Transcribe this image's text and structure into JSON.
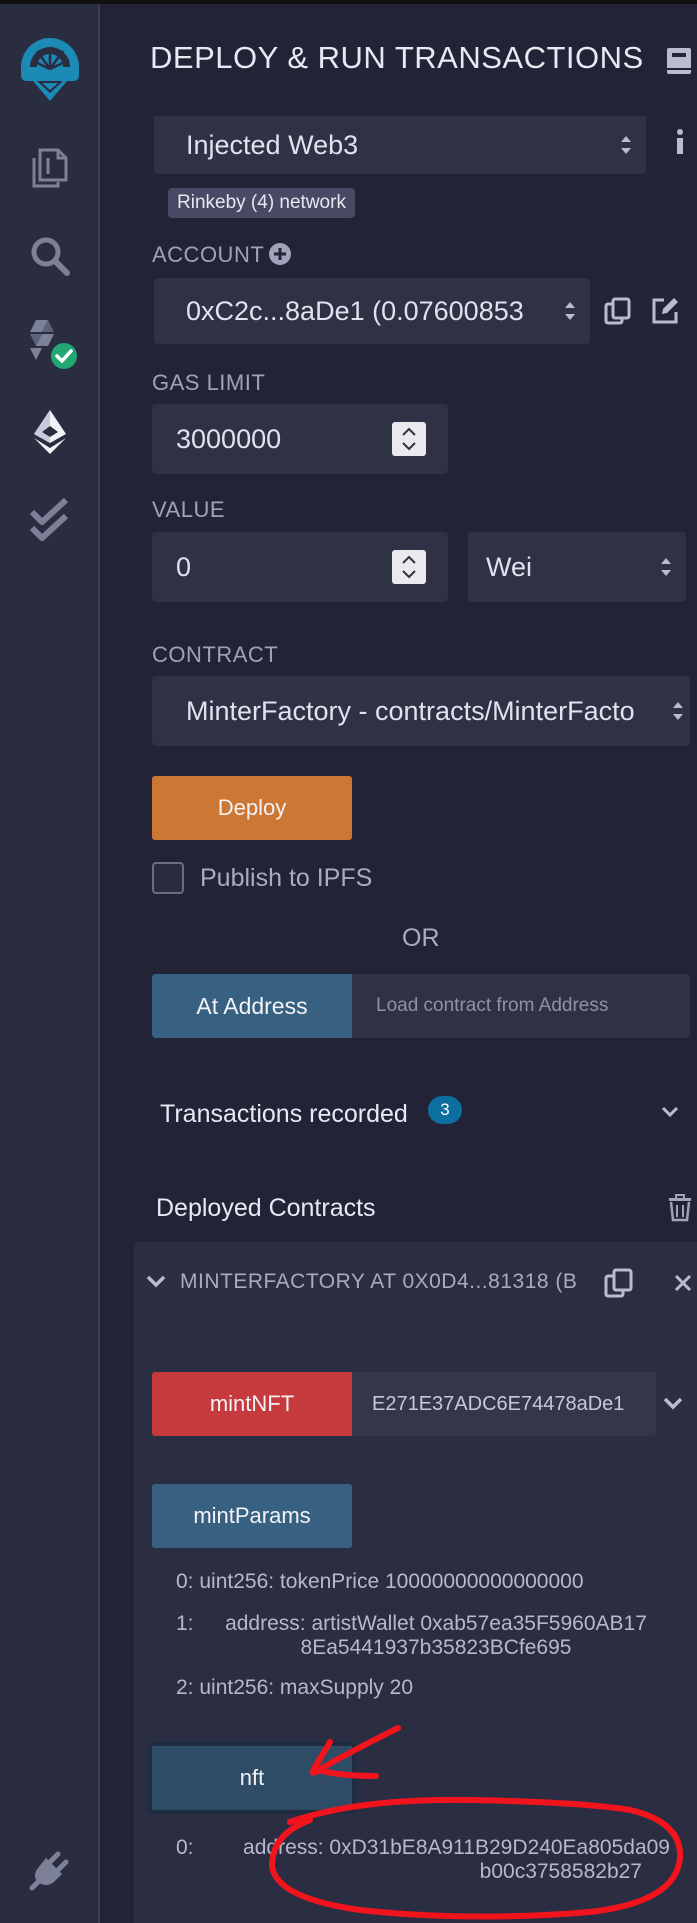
{
  "header": {
    "title": "DEPLOY & RUN TRANSACTIONS"
  },
  "environment": {
    "value": "Injected Web3",
    "network_badge": "Rinkeby (4) network"
  },
  "account": {
    "label": "ACCOUNT",
    "value": "0xC2c...8aDe1 (0.07600853"
  },
  "gas": {
    "label": "GAS LIMIT",
    "value": "3000000"
  },
  "value_field": {
    "label": "VALUE",
    "value": "0",
    "unit": "Wei"
  },
  "contract": {
    "label": "CONTRACT",
    "value": "MinterFactory - contracts/MinterFacto"
  },
  "deploy": {
    "label": "Deploy",
    "publish_label": "Publish to IPFS",
    "or_label": "OR"
  },
  "at_address": {
    "label": "At Address",
    "placeholder": "Load contract from Address"
  },
  "transactions": {
    "label": "Transactions recorded",
    "count": "3"
  },
  "deployed": {
    "title": "Deployed Contracts",
    "instance_title": "MINTERFACTORY AT 0X0D4...81318 (B",
    "mint_nft": {
      "label": "mintNFT",
      "value": "E271E37ADC6E74478aDe1"
    },
    "mint_params": {
      "label": "mintParams",
      "outputs": [
        {
          "index": "0:",
          "text": "uint256: tokenPrice 10000000000000000"
        },
        {
          "index": "1:",
          "line1": "address: artistWallet 0xab57ea35F5960AB17",
          "line2": "8Ea5441937b35823BCfe695"
        },
        {
          "index": "2:",
          "text": "uint256: maxSupply 20"
        }
      ]
    },
    "nft": {
      "label": "nft",
      "output": {
        "index": "0:",
        "line1": "address: 0xD31bE8A911B29D240Ea805da09",
        "line2": "b00c3758582b27"
      }
    }
  },
  "colors": {
    "accent_teal": "#1b8ab5",
    "deploy_orange": "#cc7834",
    "transact_red": "#c63a3d",
    "call_blue": "#386080",
    "check_green": "#22a873",
    "annotation_red": "#f2141c"
  },
  "icons": [
    "remix-logo-icon",
    "file-explorer-icon",
    "search-icon",
    "solidity-compiler-icon",
    "deploy-run-icon",
    "unit-testing-icon",
    "plugin-manager-icon",
    "book-icon",
    "info-icon",
    "plus-circle-icon",
    "copy-icon",
    "edit-icon",
    "chevron-down-icon",
    "trash-icon",
    "close-icon"
  ]
}
